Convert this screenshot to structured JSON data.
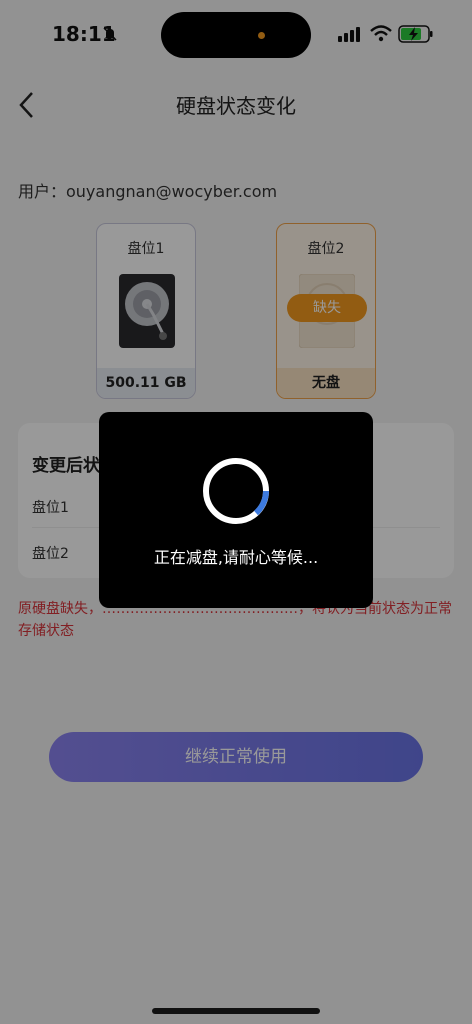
{
  "status_bar": {
    "time": "18:11"
  },
  "nav": {
    "title": "硬盘状态变化"
  },
  "user": {
    "text": "用户：ouyangnan@wocyber.com"
  },
  "disks": [
    {
      "label": "盘位1",
      "footer": "500.11 GB"
    },
    {
      "label": "盘位2",
      "footer": "无盘",
      "badge": "缺失"
    }
  ],
  "result": {
    "title": "变更后状",
    "rows": [
      "盘位1",
      "盘位2"
    ]
  },
  "warning": "原硬盘缺失，……………………………………，将认为当前状态为正常存储状态",
  "continue_button": "继续正常使用",
  "toast": {
    "text": "正在减盘,请耐心等候..."
  },
  "colors": {
    "accent": "#6a74e6",
    "warning": "#d9343b",
    "missing": "#f39a1e"
  }
}
